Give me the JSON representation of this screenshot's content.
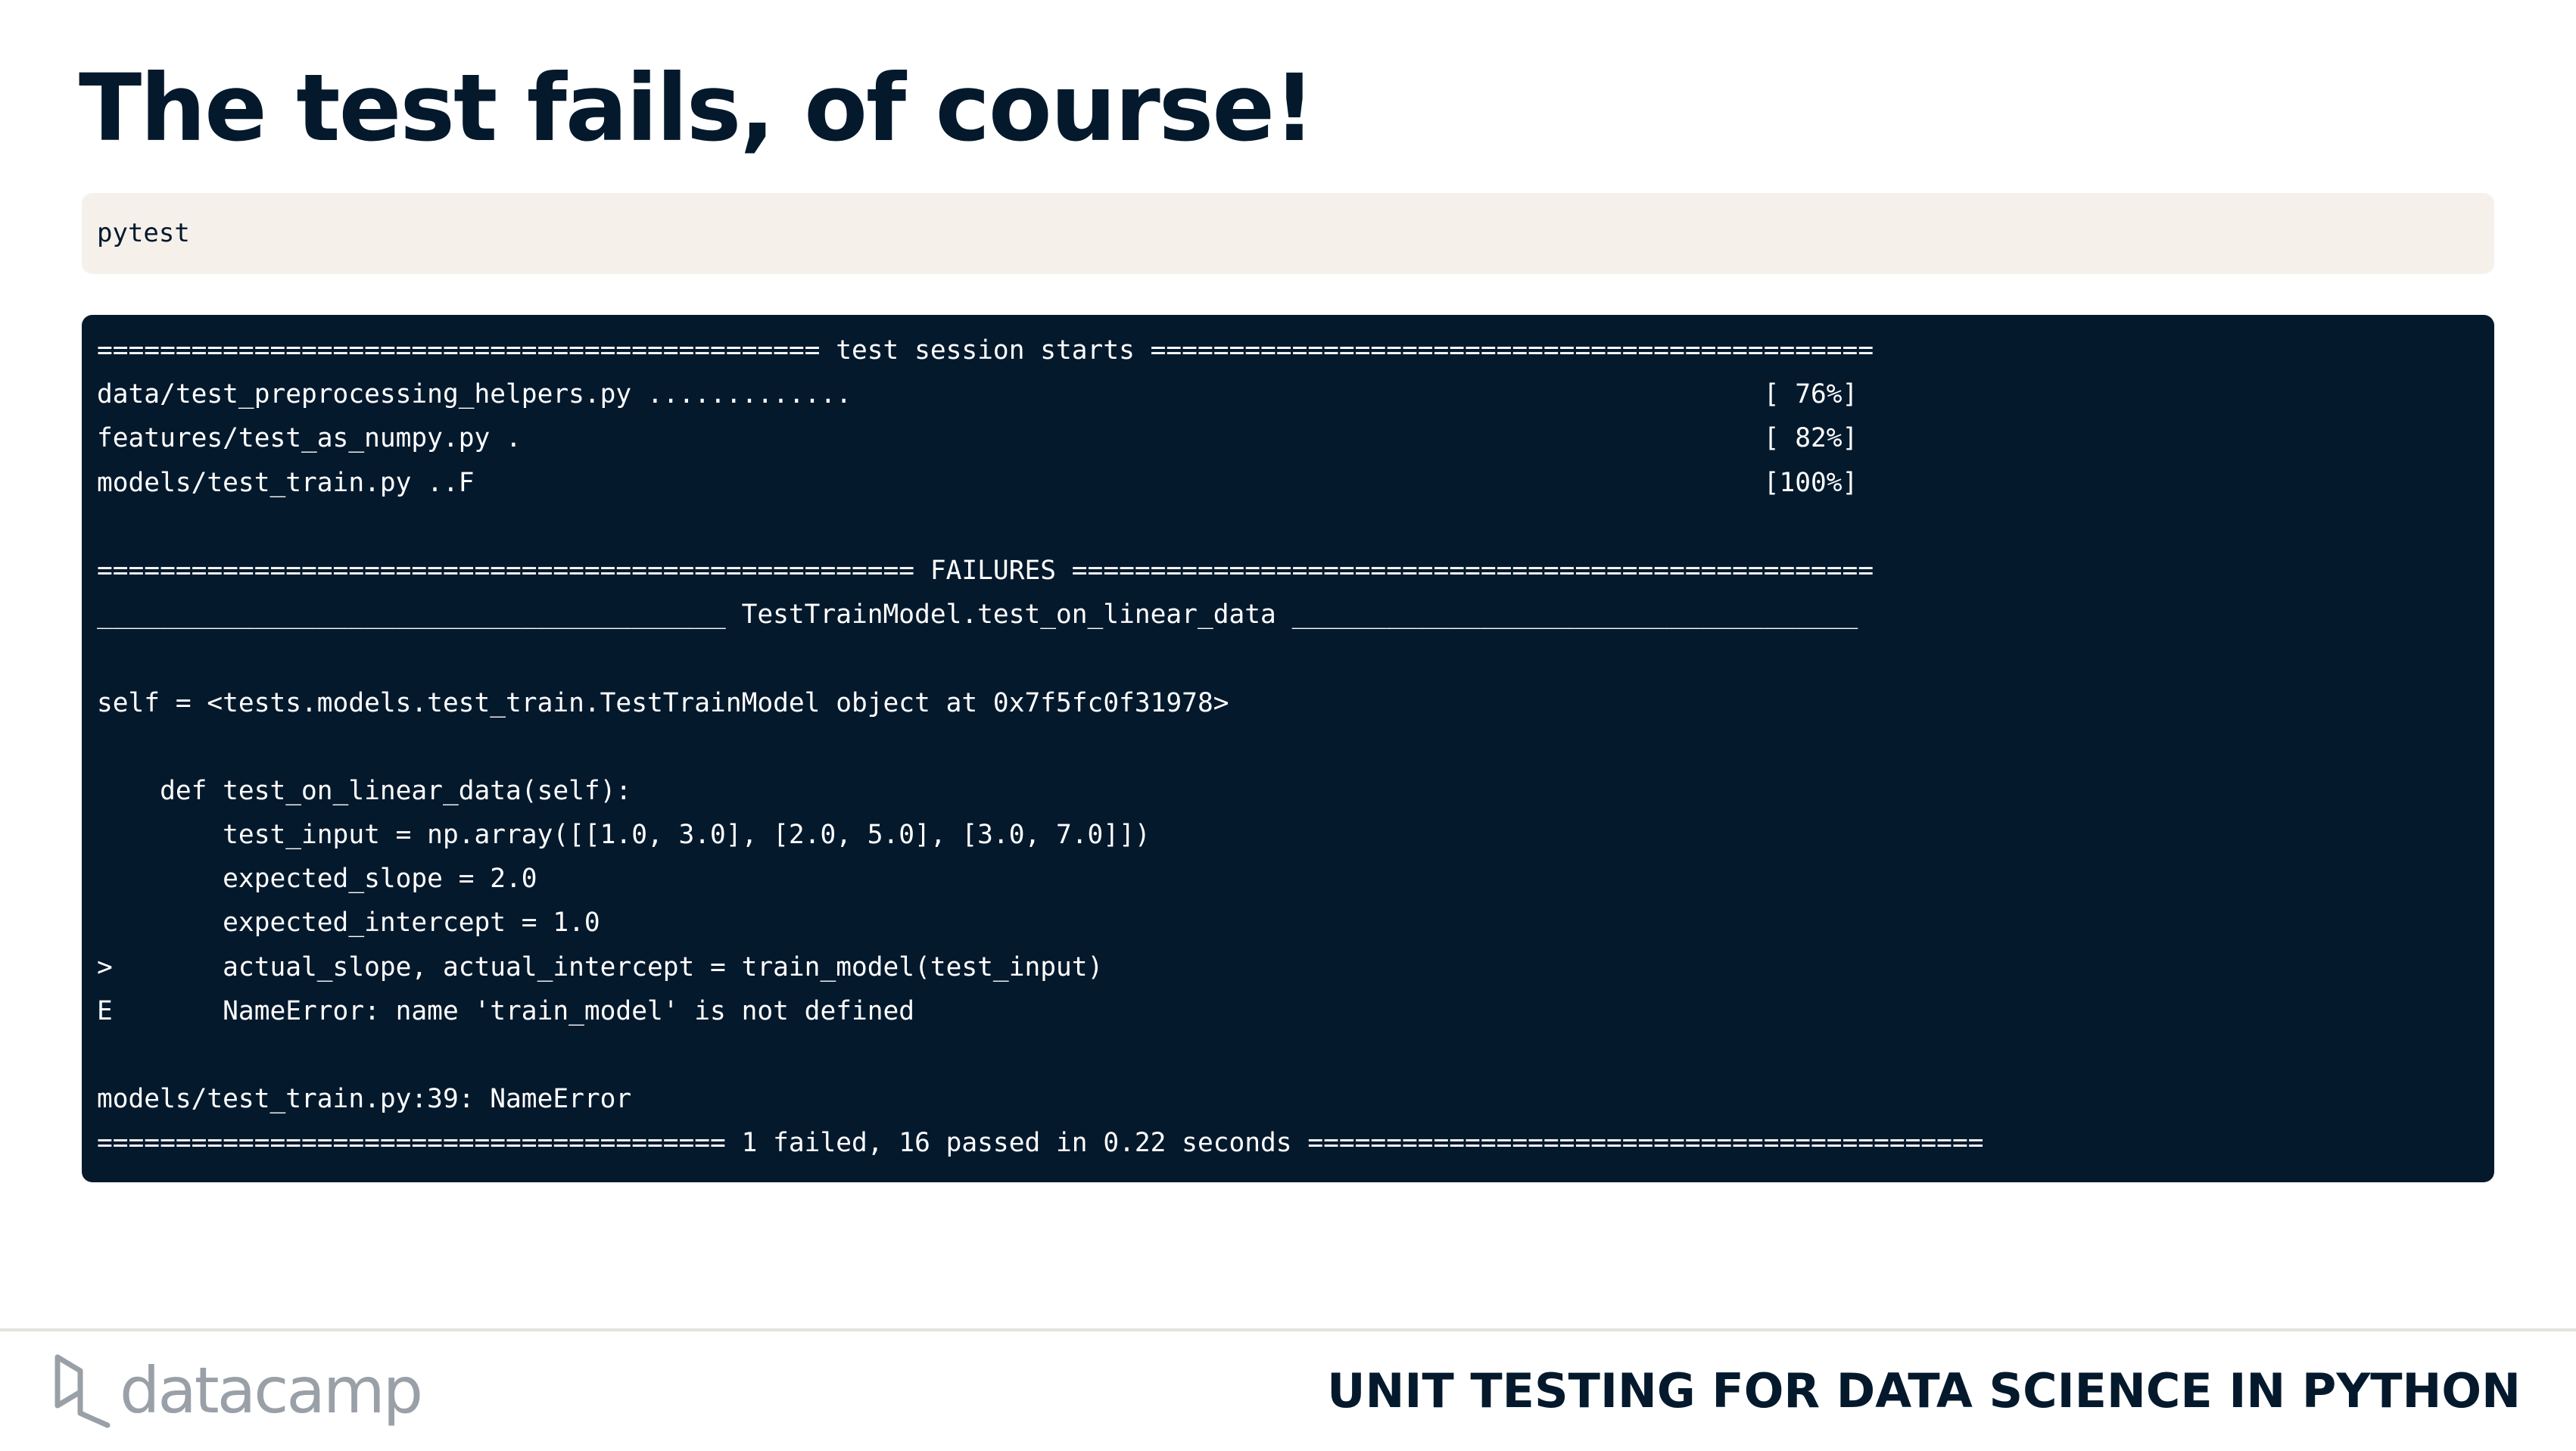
{
  "slide": {
    "title": "The test fails, of course!"
  },
  "command": {
    "text": "pytest"
  },
  "terminal": {
    "lines": [
      "============================================== test session starts ==============================================",
      "data/test_preprocessing_helpers.py .............                                                          [ 76%]",
      "features/test_as_numpy.py .                                                                               [ 82%]",
      "models/test_train.py ..F                                                                                  [100%]",
      "",
      "==================================================== FAILURES ===================================================",
      "________________________________________ TestTrainModel.test_on_linear_data ____________________________________",
      "",
      "self = <tests.models.test_train.TestTrainModel object at 0x7f5fc0f31978>",
      "",
      "    def test_on_linear_data(self):",
      "        test_input = np.array([[1.0, 3.0], [2.0, 5.0], [3.0, 7.0]])",
      "        expected_slope = 2.0",
      "        expected_intercept = 1.0",
      ">       actual_slope, actual_intercept = train_model(test_input)",
      "E       NameError: name 'train_model' is not defined",
      "",
      "models/test_train.py:39: NameError",
      "======================================== 1 failed, 16 passed in 0.22 seconds ==========================================="
    ]
  },
  "footer": {
    "logo_text": "datacamp",
    "logo_icon": "datacamp-logo-icon",
    "course_title": "UNIT TESTING FOR DATA SCIENCE IN PYTHON"
  },
  "colors": {
    "navy": "#05192d",
    "code_background": "#f5f1ea",
    "logo_grey": "#9aa0a8"
  }
}
